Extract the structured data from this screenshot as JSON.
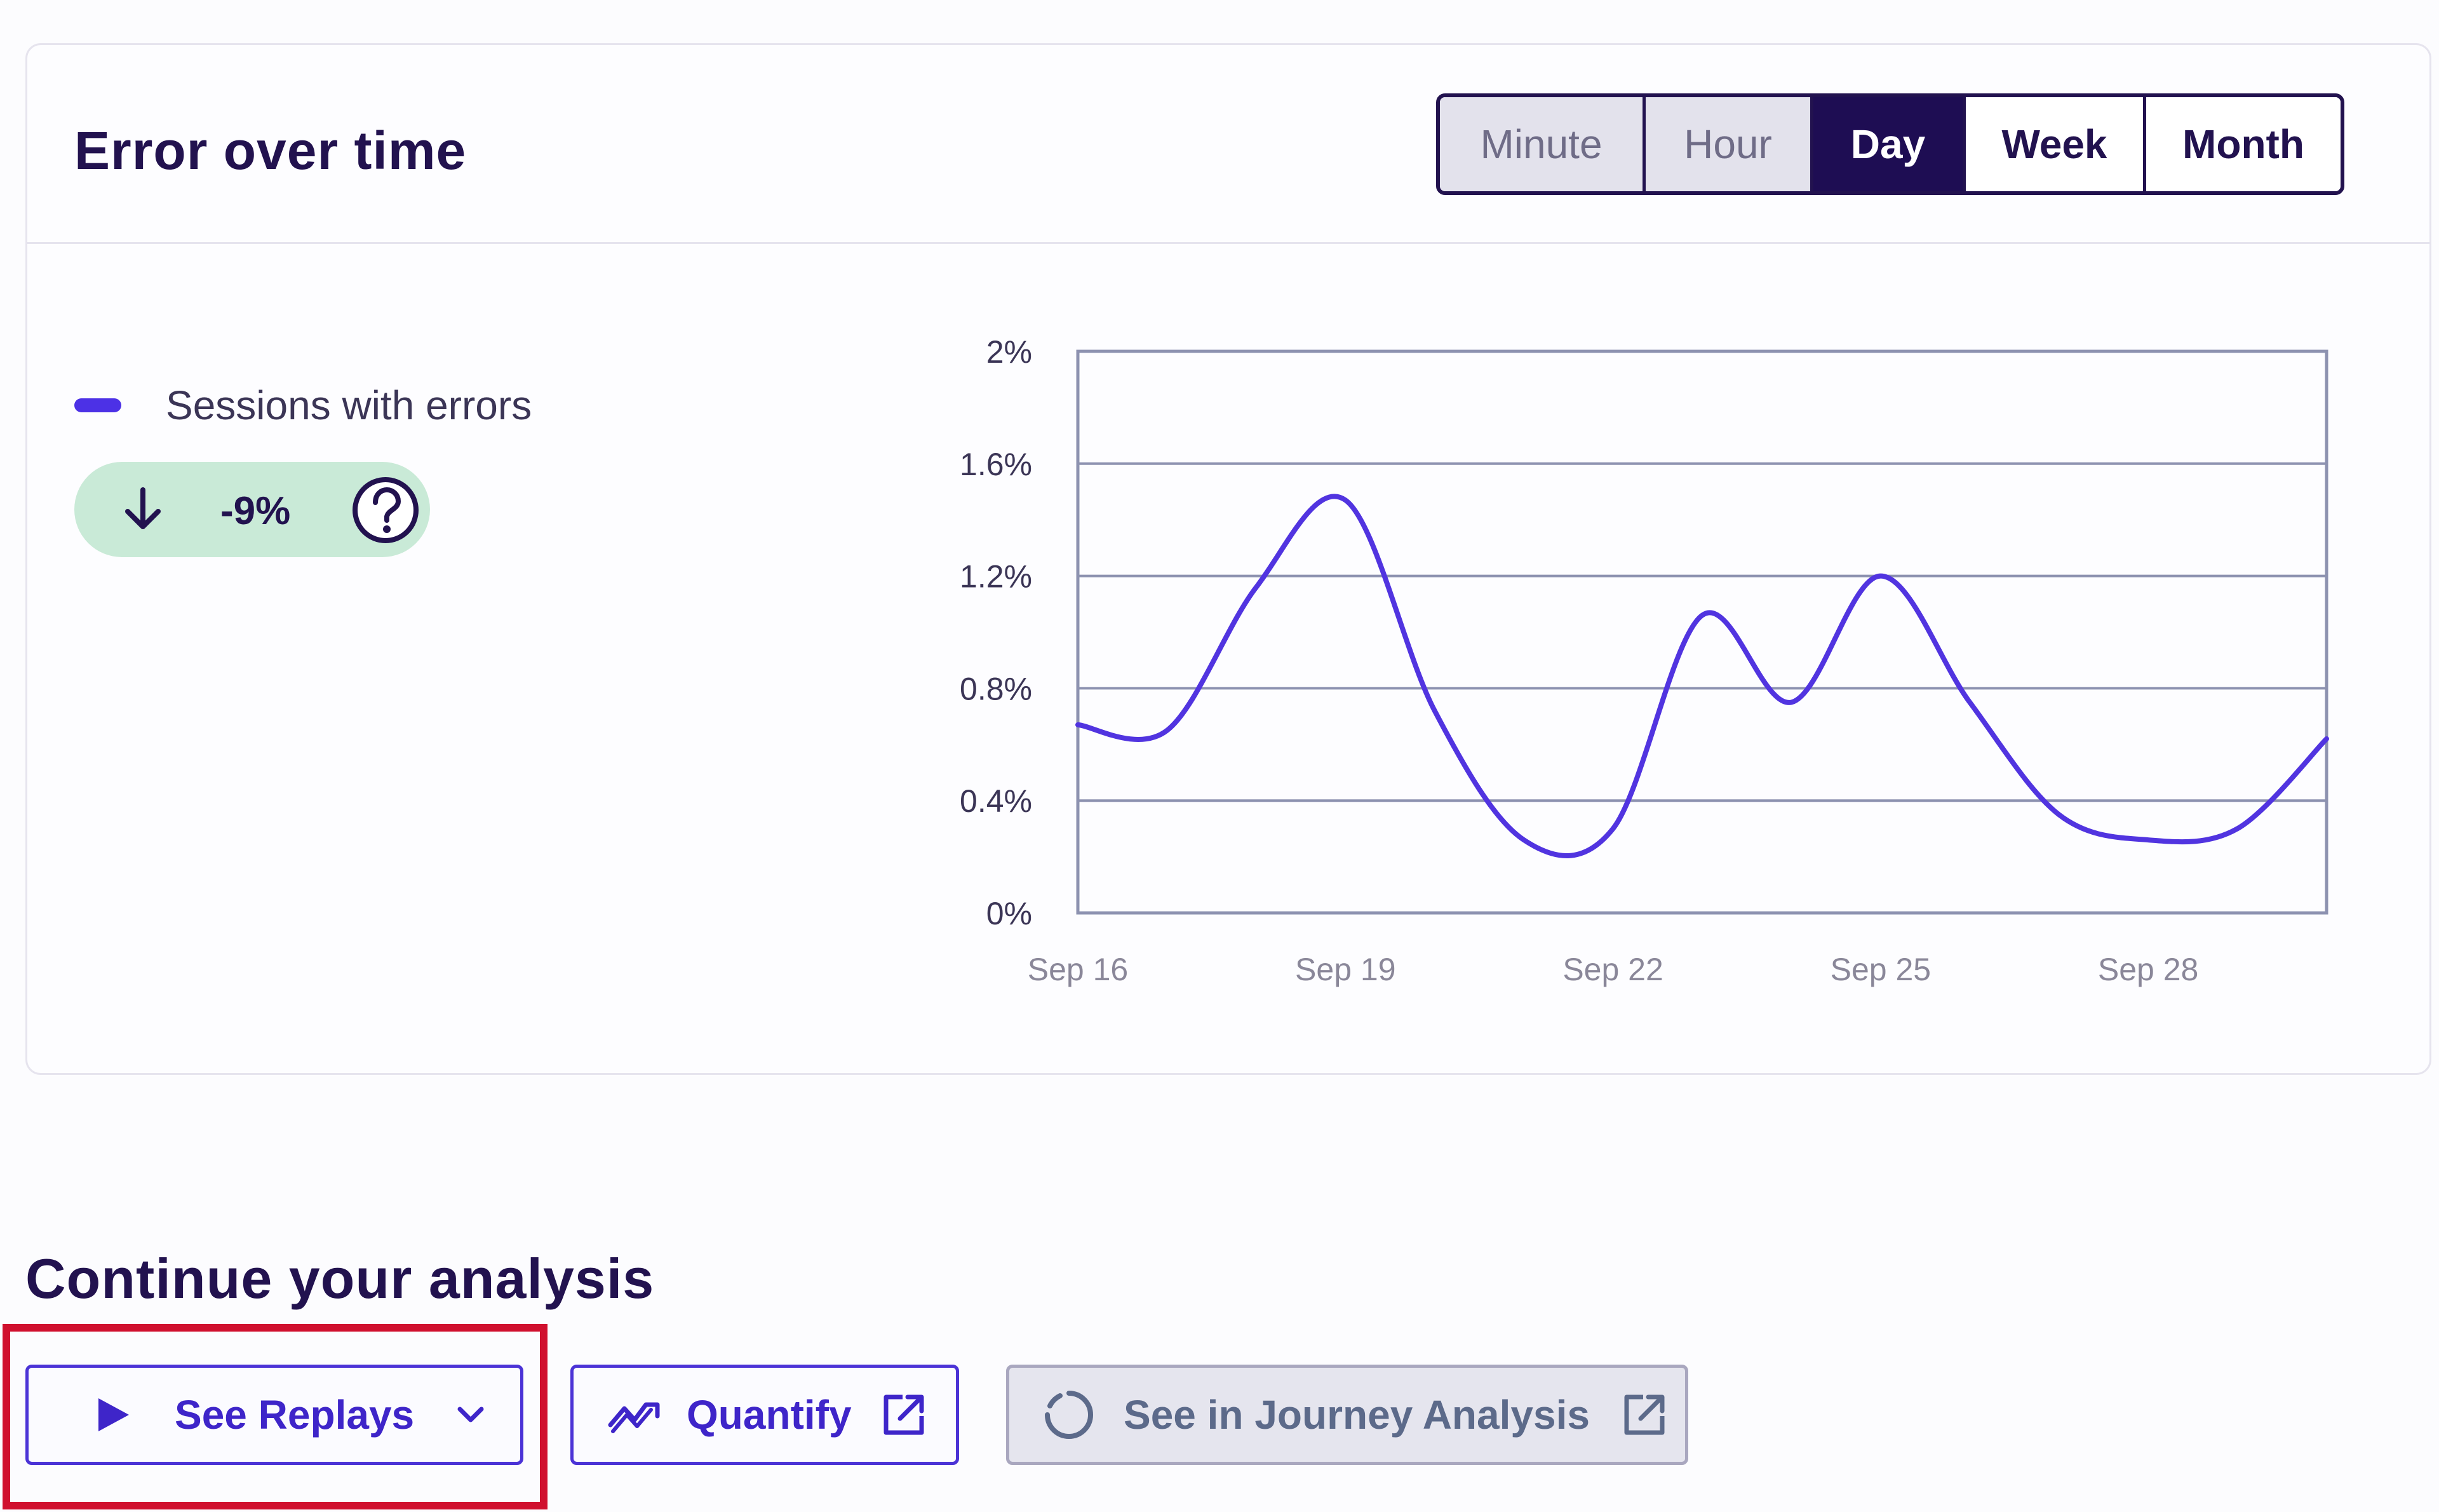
{
  "card": {
    "title": "Error over time",
    "granularity": {
      "options": [
        "Minute",
        "Hour",
        "Day",
        "Week",
        "Month"
      ],
      "selected": "Day",
      "disabled": [
        "Minute",
        "Hour"
      ]
    },
    "legend": {
      "label": "Sessions with errors",
      "color": "#4c31e6"
    },
    "change": {
      "value": "-9%",
      "direction": "down",
      "color": "#c9ead7"
    }
  },
  "chart_data": {
    "type": "line",
    "x": [
      "Sep 16",
      "Sep 17",
      "Sep 18",
      "Sep 19",
      "Sep 20",
      "Sep 21",
      "Sep 22",
      "Sep 23",
      "Sep 24",
      "Sep 25",
      "Sep 26",
      "Sep 27",
      "Sep 28",
      "Sep 29",
      "Sep 30"
    ],
    "series": [
      {
        "name": "Sessions with errors",
        "values": [
          0.67,
          0.65,
          1.16,
          1.47,
          0.72,
          0.26,
          0.3,
          1.06,
          0.75,
          1.2,
          0.75,
          0.35,
          0.26,
          0.3,
          0.62
        ]
      }
    ],
    "xticks": [
      "Sep 16",
      "Sep 19",
      "Sep 22",
      "Sep 25",
      "Sep 28"
    ],
    "yticks": [
      "0%",
      "0.4%",
      "0.8%",
      "1.2%",
      "1.6%",
      "2%"
    ],
    "ylim": [
      0,
      2
    ],
    "grid": true,
    "line_color": "#5134e0"
  },
  "analysis": {
    "title": "Continue your analysis",
    "buttons": {
      "replays": "See Replays",
      "quantify": "Quantify",
      "journey": "See in Journey Analysis"
    }
  },
  "colors": {
    "primary": "#22124f",
    "accent": "#4b33d6",
    "highlight": "#d0102e"
  }
}
